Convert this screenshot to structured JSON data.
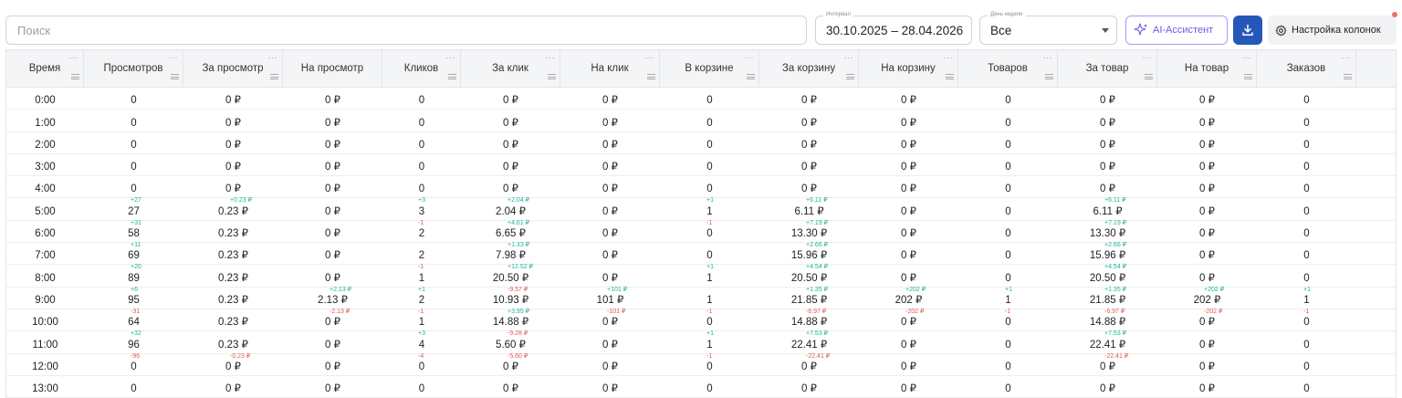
{
  "toolbar": {
    "search_placeholder": "Поиск",
    "interval": {
      "label": "Интервал",
      "value": "30.10.2025 – 28.04.2026"
    },
    "weekday": {
      "label": "День недели",
      "value": "Все"
    },
    "ai_label": "AI-Ассистент",
    "columns_label": "Настройка колонок"
  },
  "colors": {
    "accent": "#2557b8",
    "ai": "#6a5be6",
    "positive": "#21b29a",
    "negative": "#e05a55"
  },
  "table": {
    "columns": [
      "Время",
      "Просмотров",
      "За просмотр",
      "На просмотр",
      "Кликов",
      "За клик",
      "На клик",
      "В корзине",
      "За корзину",
      "На корзину",
      "Товаров",
      "За товар",
      "На товар",
      "Заказов"
    ],
    "rows": [
      {
        "cells": [
          "0:00",
          "0",
          "0 ₽",
          "0 ₽",
          "0",
          "0 ₽",
          "0 ₽",
          "0",
          "0 ₽",
          "0 ₽",
          "0",
          "0 ₽",
          "0 ₽",
          "0"
        ]
      },
      {
        "cells": [
          "1:00",
          "0",
          "0 ₽",
          "0 ₽",
          "0",
          "0 ₽",
          "0 ₽",
          "0",
          "0 ₽",
          "0 ₽",
          "0",
          "0 ₽",
          "0 ₽",
          "0"
        ]
      },
      {
        "cells": [
          "2:00",
          "0",
          "0 ₽",
          "0 ₽",
          "0",
          "0 ₽",
          "0 ₽",
          "0",
          "0 ₽",
          "0 ₽",
          "0",
          "0 ₽",
          "0 ₽",
          "0"
        ]
      },
      {
        "cells": [
          "3:00",
          "0",
          "0 ₽",
          "0 ₽",
          "0",
          "0 ₽",
          "0 ₽",
          "0",
          "0 ₽",
          "0 ₽",
          "0",
          "0 ₽",
          "0 ₽",
          "0"
        ]
      },
      {
        "cells": [
          "4:00",
          "0",
          "0 ₽",
          "0 ₽",
          "0",
          "0 ₽",
          "0 ₽",
          "0",
          "0 ₽",
          "0 ₽",
          "0",
          "0 ₽",
          "0 ₽",
          "0"
        ]
      },
      {
        "cells": [
          "5:00",
          "27",
          "0.23 ₽",
          "0 ₽",
          "3",
          "2.04 ₽",
          "0 ₽",
          "1",
          "6.11 ₽",
          "0 ₽",
          "0",
          "6.11 ₽",
          "0 ₽",
          "0"
        ],
        "deltas": [
          "",
          "+27",
          "+0.23 ₽",
          "",
          "+3",
          "+2.04 ₽",
          "",
          "+1",
          "+6.11 ₽",
          "",
          "",
          "+6.11 ₽",
          "",
          ""
        ]
      },
      {
        "cells": [
          "6:00",
          "58",
          "0.23 ₽",
          "0 ₽",
          "2",
          "6.65 ₽",
          "0 ₽",
          "0",
          "13.30 ₽",
          "0 ₽",
          "0",
          "13.30 ₽",
          "0 ₽",
          "0"
        ],
        "deltas": [
          "",
          "+31",
          "",
          "",
          "-1",
          "+4.61 ₽",
          "",
          "-1",
          "+7.19 ₽",
          "",
          "",
          "+7.19 ₽",
          "",
          ""
        ]
      },
      {
        "cells": [
          "7:00",
          "69",
          "0.23 ₽",
          "0 ₽",
          "2",
          "7.98 ₽",
          "0 ₽",
          "0",
          "15.96 ₽",
          "0 ₽",
          "0",
          "15.96 ₽",
          "0 ₽",
          "0"
        ],
        "deltas": [
          "",
          "+11",
          "",
          "",
          "",
          "+1.33 ₽",
          "",
          "",
          "+2.66 ₽",
          "",
          "",
          "+2.66 ₽",
          "",
          ""
        ]
      },
      {
        "cells": [
          "8:00",
          "89",
          "0.23 ₽",
          "0 ₽",
          "1",
          "20.50 ₽",
          "0 ₽",
          "1",
          "20.50 ₽",
          "0 ₽",
          "0",
          "20.50 ₽",
          "0 ₽",
          "0"
        ],
        "deltas": [
          "",
          "+20",
          "",
          "",
          "-1",
          "+12.52 ₽",
          "",
          "+1",
          "+4.54 ₽",
          "",
          "",
          "+4.54 ₽",
          "",
          ""
        ]
      },
      {
        "cells": [
          "9:00",
          "95",
          "0.23 ₽",
          "2.13 ₽",
          "2",
          "10.93 ₽",
          "101 ₽",
          "1",
          "21.85 ₽",
          "202 ₽",
          "1",
          "21.85 ₽",
          "202 ₽",
          "1"
        ],
        "deltas": [
          "",
          "+6",
          "",
          "+2.13 ₽",
          "+1",
          "-9.57 ₽",
          "+101 ₽",
          "",
          "+1.35 ₽",
          "+202 ₽",
          "+1",
          "+1.35 ₽",
          "+202 ₽",
          "+1"
        ]
      },
      {
        "cells": [
          "10:00",
          "64",
          "0.23 ₽",
          "0 ₽",
          "1",
          "14.88 ₽",
          "0 ₽",
          "0",
          "14.88 ₽",
          "0 ₽",
          "0",
          "14.88 ₽",
          "0 ₽",
          "0"
        ],
        "deltas": [
          "",
          "-31",
          "",
          "-2.13 ₽",
          "-1",
          "+3.95 ₽",
          "-101 ₽",
          "-1",
          "-6.97 ₽",
          "-202 ₽",
          "-1",
          "-6.97 ₽",
          "-202 ₽",
          "-1"
        ]
      },
      {
        "cells": [
          "11:00",
          "96",
          "0.23 ₽",
          "0 ₽",
          "4",
          "5.60 ₽",
          "0 ₽",
          "1",
          "22.41 ₽",
          "0 ₽",
          "0",
          "22.41 ₽",
          "0 ₽",
          "0"
        ],
        "deltas": [
          "",
          "+32",
          "",
          "",
          "+3",
          "-9.28 ₽",
          "",
          "+1",
          "+7.53 ₽",
          "",
          "",
          "+7.53 ₽",
          "",
          ""
        ]
      },
      {
        "cells": [
          "12:00",
          "0",
          "0 ₽",
          "0 ₽",
          "0",
          "0 ₽",
          "0 ₽",
          "0",
          "0 ₽",
          "0 ₽",
          "0",
          "0 ₽",
          "0 ₽",
          "0"
        ],
        "deltas": [
          "",
          "-96",
          "-0.23 ₽",
          "",
          "-4",
          "-5.60 ₽",
          "",
          "-1",
          "-22.41 ₽",
          "",
          "",
          "-22.41 ₽",
          "",
          ""
        ]
      },
      {
        "cells": [
          "13:00",
          "0",
          "0 ₽",
          "0 ₽",
          "0",
          "0 ₽",
          "0 ₽",
          "0",
          "0 ₽",
          "0 ₽",
          "0",
          "0 ₽",
          "0 ₽",
          "0"
        ]
      }
    ]
  }
}
